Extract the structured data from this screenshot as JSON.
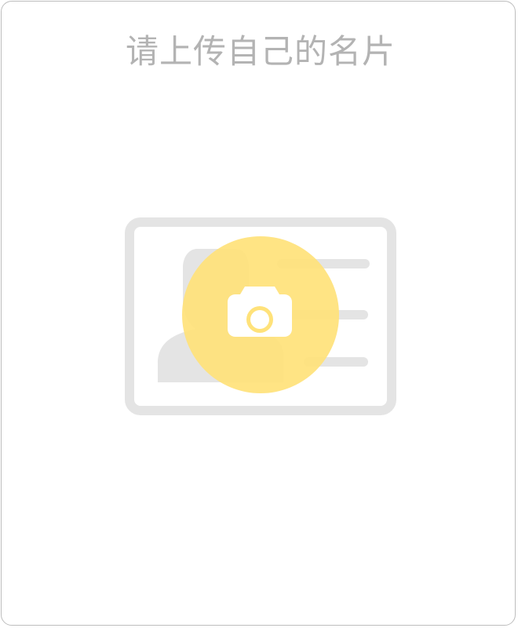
{
  "title": "请上传自己的名片",
  "upload": {
    "card_icon": "business-card-icon",
    "camera_icon": "camera-icon"
  },
  "colors": {
    "title_text": "#b3b3b3",
    "card_gray": "#e4e4e4",
    "accent_yellow": "#ffe27a",
    "border": "#bdbdbd"
  }
}
